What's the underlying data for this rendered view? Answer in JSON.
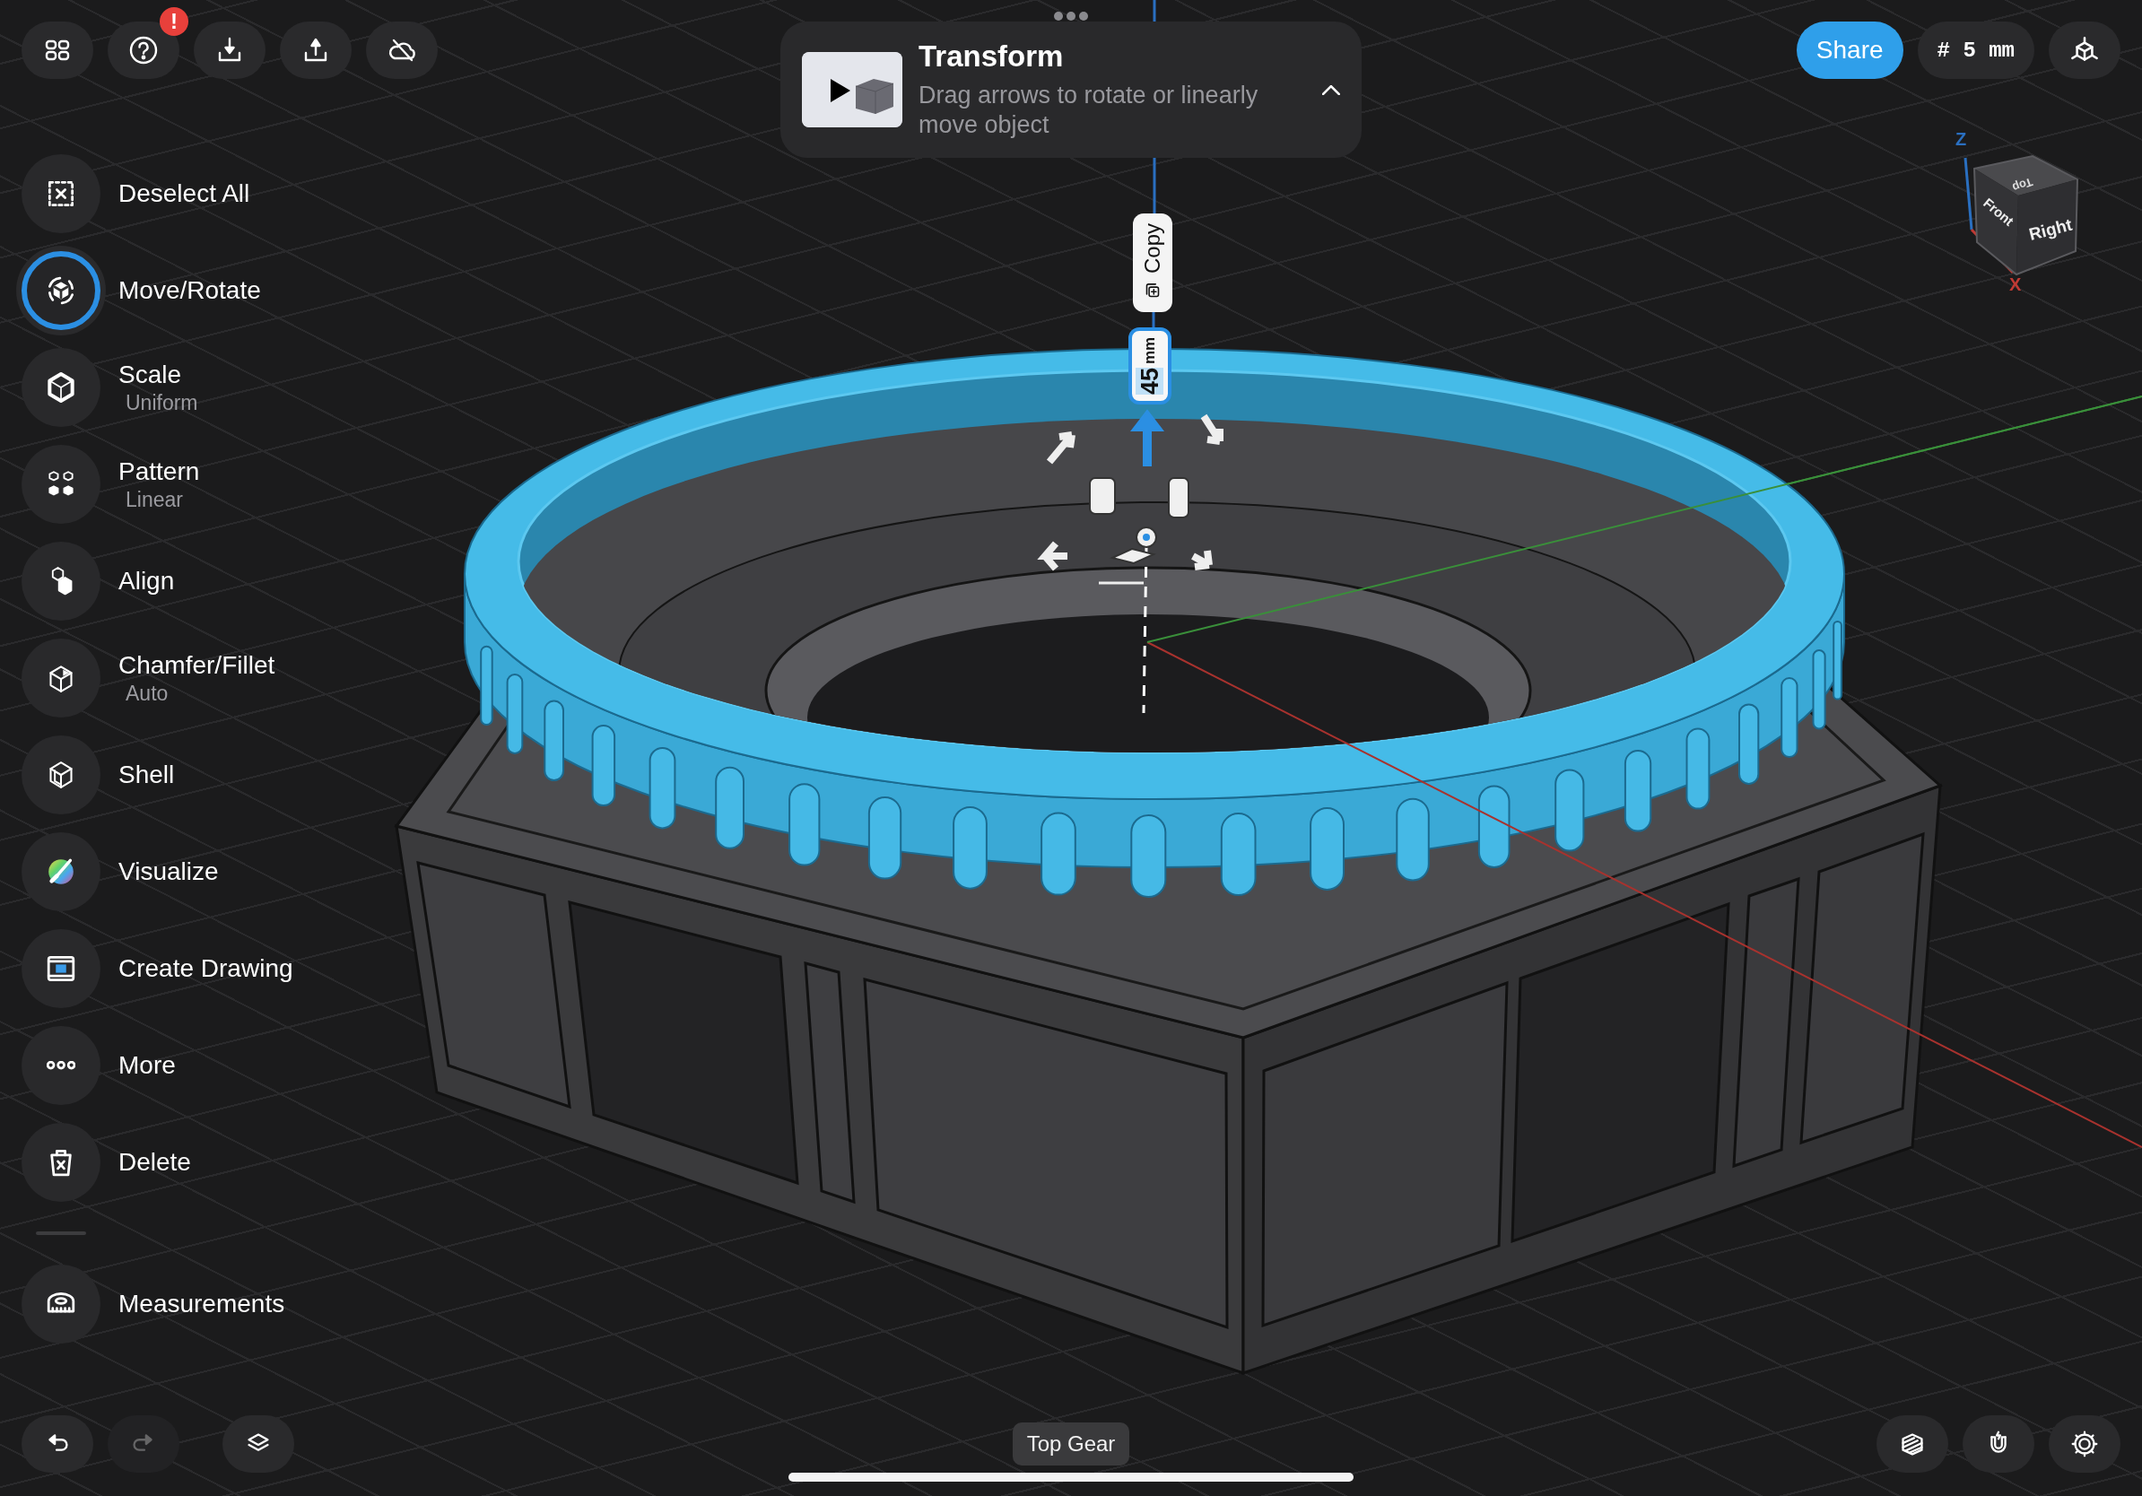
{
  "toolbar": {
    "alert_badge": "!"
  },
  "tutorial": {
    "title": "Transform",
    "description": "Drag arrows to rotate or linearly move object",
    "expanded": true
  },
  "share_button": "Share",
  "grid_size": "# 5 mm",
  "view_cube": {
    "faces": [
      "Top",
      "Front",
      "Right"
    ],
    "axes": [
      "Z",
      "X"
    ]
  },
  "sidebar": {
    "items": [
      {
        "kind": "deselect",
        "label": "Deselect All",
        "selected": false
      },
      {
        "kind": "move",
        "label": "Move/Rotate",
        "selected": true
      },
      {
        "kind": "scale",
        "label": "Scale",
        "subtitle": "Uniform",
        "selected": false
      },
      {
        "kind": "pattern",
        "label": "Pattern",
        "subtitle": "Linear",
        "selected": false
      },
      {
        "kind": "align",
        "label": "Align",
        "selected": false
      },
      {
        "kind": "chamfer",
        "label": "Chamfer/Fillet",
        "subtitle": "Auto",
        "selected": false
      },
      {
        "kind": "shell",
        "label": "Shell",
        "selected": false
      },
      {
        "kind": "visualize",
        "label": "Visualize",
        "selected": false
      },
      {
        "kind": "drawing",
        "label": "Create Drawing",
        "selected": false
      },
      {
        "kind": "more",
        "label": "More",
        "selected": false
      },
      {
        "kind": "delete",
        "label": "Delete",
        "selected": false
      }
    ],
    "footer": [
      {
        "kind": "measure",
        "label": "Measurements",
        "selected": false
      }
    ]
  },
  "manipulator": {
    "copy_label": "Copy",
    "distance": "45",
    "unit": "mm"
  },
  "bottom_bar": {
    "undo": {
      "disabled": false
    },
    "redo": {
      "disabled": true
    },
    "object_name": "Top Gear"
  }
}
